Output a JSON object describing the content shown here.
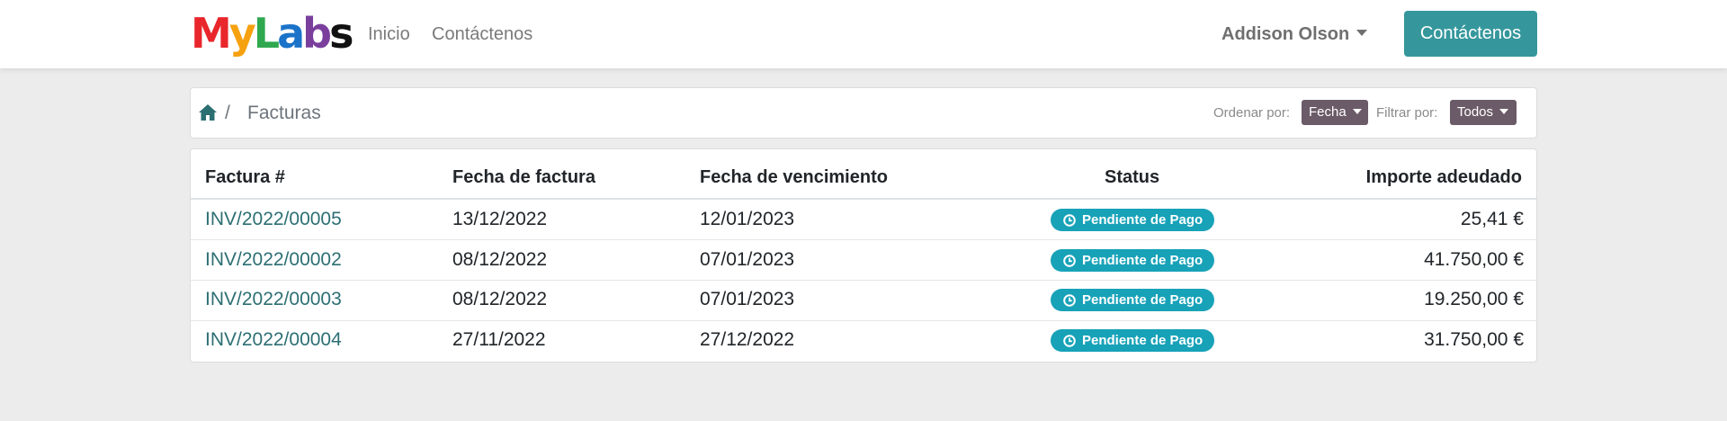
{
  "brand": {
    "logo_text": "MyLabs"
  },
  "nav": {
    "links": [
      "Inicio",
      "Contáctenos"
    ],
    "user_name": "Addison Olson",
    "cta_label": "Contáctenos"
  },
  "breadcrumb": {
    "current": "Facturas",
    "separator": "/"
  },
  "controls": {
    "sort_label": "Ordenar por:",
    "sort_value": "Fecha",
    "filter_label": "Filtrar por:",
    "filter_value": "Todos"
  },
  "table": {
    "headers": [
      "Factura #",
      "Fecha de factura",
      "Fecha de vencimiento",
      "Status",
      "Importe adeudado"
    ],
    "rows": [
      {
        "invoice": "INV/2022/00005",
        "date": "13/12/2022",
        "due": "12/01/2023",
        "status": "Pendiente de Pago",
        "amount": "25,41 €"
      },
      {
        "invoice": "INV/2022/00002",
        "date": "08/12/2022",
        "due": "07/01/2023",
        "status": "Pendiente de Pago",
        "amount": "41.750,00 €"
      },
      {
        "invoice": "INV/2022/00003",
        "date": "08/12/2022",
        "due": "07/01/2023",
        "status": "Pendiente de Pago",
        "amount": "19.250,00 €"
      },
      {
        "invoice": "INV/2022/00004",
        "date": "27/11/2022",
        "due": "27/12/2022",
        "status": "Pendiente de Pago",
        "amount": "31.750,00 €"
      }
    ]
  },
  "colors": {
    "primary": "#35979c",
    "link": "#2c6f73",
    "badge": "#17a2b8",
    "pill": "#6b5a67",
    "background": "#ececec",
    "logo": [
      "#e8262b",
      "#f6a10f",
      "#2fa84f",
      "#1b73c9",
      "#7a3f9d",
      "#111111"
    ]
  },
  "icons": {
    "home": "home-icon",
    "caret": "caret-down-icon",
    "status": "clock-icon"
  }
}
